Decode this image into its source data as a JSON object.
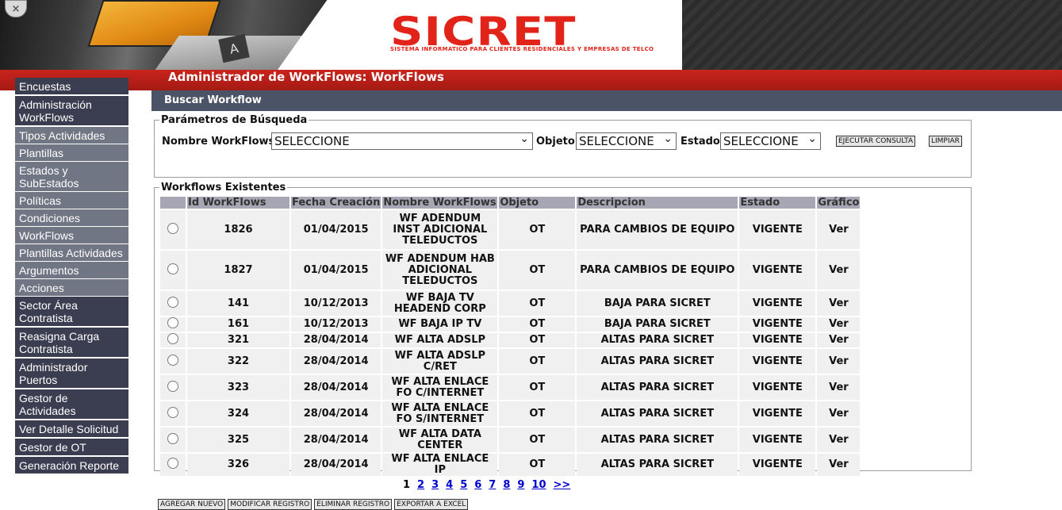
{
  "header": {
    "close_icon": "×",
    "logo_text": "SICRET",
    "logo_subtitle": "SISTEMA INFORMATICO PARA CLIENTES RESIDENCIALES Y EMPRESAS DE TELCO",
    "laptop_key": "A"
  },
  "title_bar": {
    "title": "Administrador de WorkFlows: WorkFlows"
  },
  "sidebar": {
    "items": [
      {
        "label": "Encuestas",
        "style": "dark"
      },
      {
        "label": "Administración WorkFlows",
        "style": "dark"
      },
      {
        "label": "Tipos Actividades",
        "style": "light"
      },
      {
        "label": "Plantillas",
        "style": "light"
      },
      {
        "label": "Estados y SubEstados",
        "style": "light"
      },
      {
        "label": "Políticas",
        "style": "light"
      },
      {
        "label": "Condiciones",
        "style": "light"
      },
      {
        "label": "WorkFlows",
        "style": "light"
      },
      {
        "label": "Plantillas Actividades",
        "style": "light"
      },
      {
        "label": "Argumentos",
        "style": "light"
      },
      {
        "label": "Acciones",
        "style": "light"
      },
      {
        "label": "Sector Área Contratista",
        "style": "dark"
      },
      {
        "label": "Reasigna Carga Contratista",
        "style": "dark"
      },
      {
        "label": "Administrador Puertos",
        "style": "dark"
      },
      {
        "label": "Gestor de Actividades",
        "style": "dark"
      },
      {
        "label": "Ver Detalle Solicitud",
        "style": "dark"
      },
      {
        "label": "Gestor de OT",
        "style": "dark"
      },
      {
        "label": "Generación Reporte",
        "style": "dark"
      }
    ]
  },
  "search": {
    "section_title": "Buscar Workflow",
    "legend": "Parámetros de Búsqueda",
    "nombre_label": "Nombre WorkFlows",
    "nombre_value": "SELECCIONE",
    "objeto_label": "Objeto",
    "objeto_value": "SELECCIONE",
    "estado_label": "Estado",
    "estado_value": "SELECCIONE",
    "execute_button": "EJECUTAR CONSULTA",
    "clear_button": "LIMPIAR"
  },
  "results": {
    "legend": "Workflows Existentes",
    "columns": [
      "Id WorkFlows",
      "Fecha Creación",
      "Nombre WorkFlows",
      "Objeto",
      "Descripcion",
      "Estado",
      "Gráfico"
    ],
    "rows": [
      {
        "id": "1826",
        "fecha": "01/04/2015",
        "nombre": "WF ADENDUM INST ADICIONAL TELEDUCTOS",
        "objeto": "OT",
        "descripcion": "PARA CAMBIOS DE EQUIPO",
        "estado": "VIGENTE",
        "grafico": "Ver"
      },
      {
        "id": "1827",
        "fecha": "01/04/2015",
        "nombre": "WF ADENDUM HAB ADICIONAL TELEDUCTOS",
        "objeto": "OT",
        "descripcion": "PARA CAMBIOS DE EQUIPO",
        "estado": "VIGENTE",
        "grafico": "Ver"
      },
      {
        "id": "141",
        "fecha": "10/12/2013",
        "nombre": "WF BAJA TV HEADEND CORP",
        "objeto": "OT",
        "descripcion": "BAJA PARA SICRET",
        "estado": "VIGENTE",
        "grafico": "Ver"
      },
      {
        "id": "161",
        "fecha": "10/12/2013",
        "nombre": "WF BAJA IP TV",
        "objeto": "OT",
        "descripcion": "BAJA PARA SICRET",
        "estado": "VIGENTE",
        "grafico": "Ver"
      },
      {
        "id": "321",
        "fecha": "28/04/2014",
        "nombre": "WF ALTA ADSLP",
        "objeto": "OT",
        "descripcion": "ALTAS PARA SICRET",
        "estado": "VIGENTE",
        "grafico": "Ver"
      },
      {
        "id": "322",
        "fecha": "28/04/2014",
        "nombre": "WF ALTA ADSLP C/RET",
        "objeto": "OT",
        "descripcion": "ALTAS PARA SICRET",
        "estado": "VIGENTE",
        "grafico": "Ver"
      },
      {
        "id": "323",
        "fecha": "28/04/2014",
        "nombre": "WF ALTA ENLACE FO C/INTERNET",
        "objeto": "OT",
        "descripcion": "ALTAS PARA SICRET",
        "estado": "VIGENTE",
        "grafico": "Ver"
      },
      {
        "id": "324",
        "fecha": "28/04/2014",
        "nombre": "WF ALTA ENLACE FO S/INTERNET",
        "objeto": "OT",
        "descripcion": "ALTAS PARA SICRET",
        "estado": "VIGENTE",
        "grafico": "Ver"
      },
      {
        "id": "325",
        "fecha": "28/04/2014",
        "nombre": "WF ALTA DATA CENTER",
        "objeto": "OT",
        "descripcion": "ALTAS PARA SICRET",
        "estado": "VIGENTE",
        "grafico": "Ver"
      },
      {
        "id": "326",
        "fecha": "28/04/2014",
        "nombre": "WF ALTA ENLACE IP",
        "objeto": "OT",
        "descripcion": "ALTAS PARA SICRET",
        "estado": "VIGENTE",
        "grafico": "Ver"
      }
    ]
  },
  "pagination": {
    "current": "1",
    "pages": [
      "2",
      "3",
      "4",
      "5",
      "6",
      "7",
      "8",
      "9",
      "10"
    ],
    "next": ">>"
  },
  "actions": [
    "AGREGAR NUEVO",
    "MODIFICAR REGISTRO",
    "ELIMINAR REGISTRO",
    "EXPORTAR A EXCEL"
  ],
  "colors": {
    "title_red": "#c9241c",
    "sidebar_dark": "#3b3e51",
    "sidebar_light": "#707683",
    "section_bar": "#4b5366",
    "table_header": "#a6a6b4",
    "logo_red": "#e2231a",
    "link_blue": "#0000cc"
  }
}
